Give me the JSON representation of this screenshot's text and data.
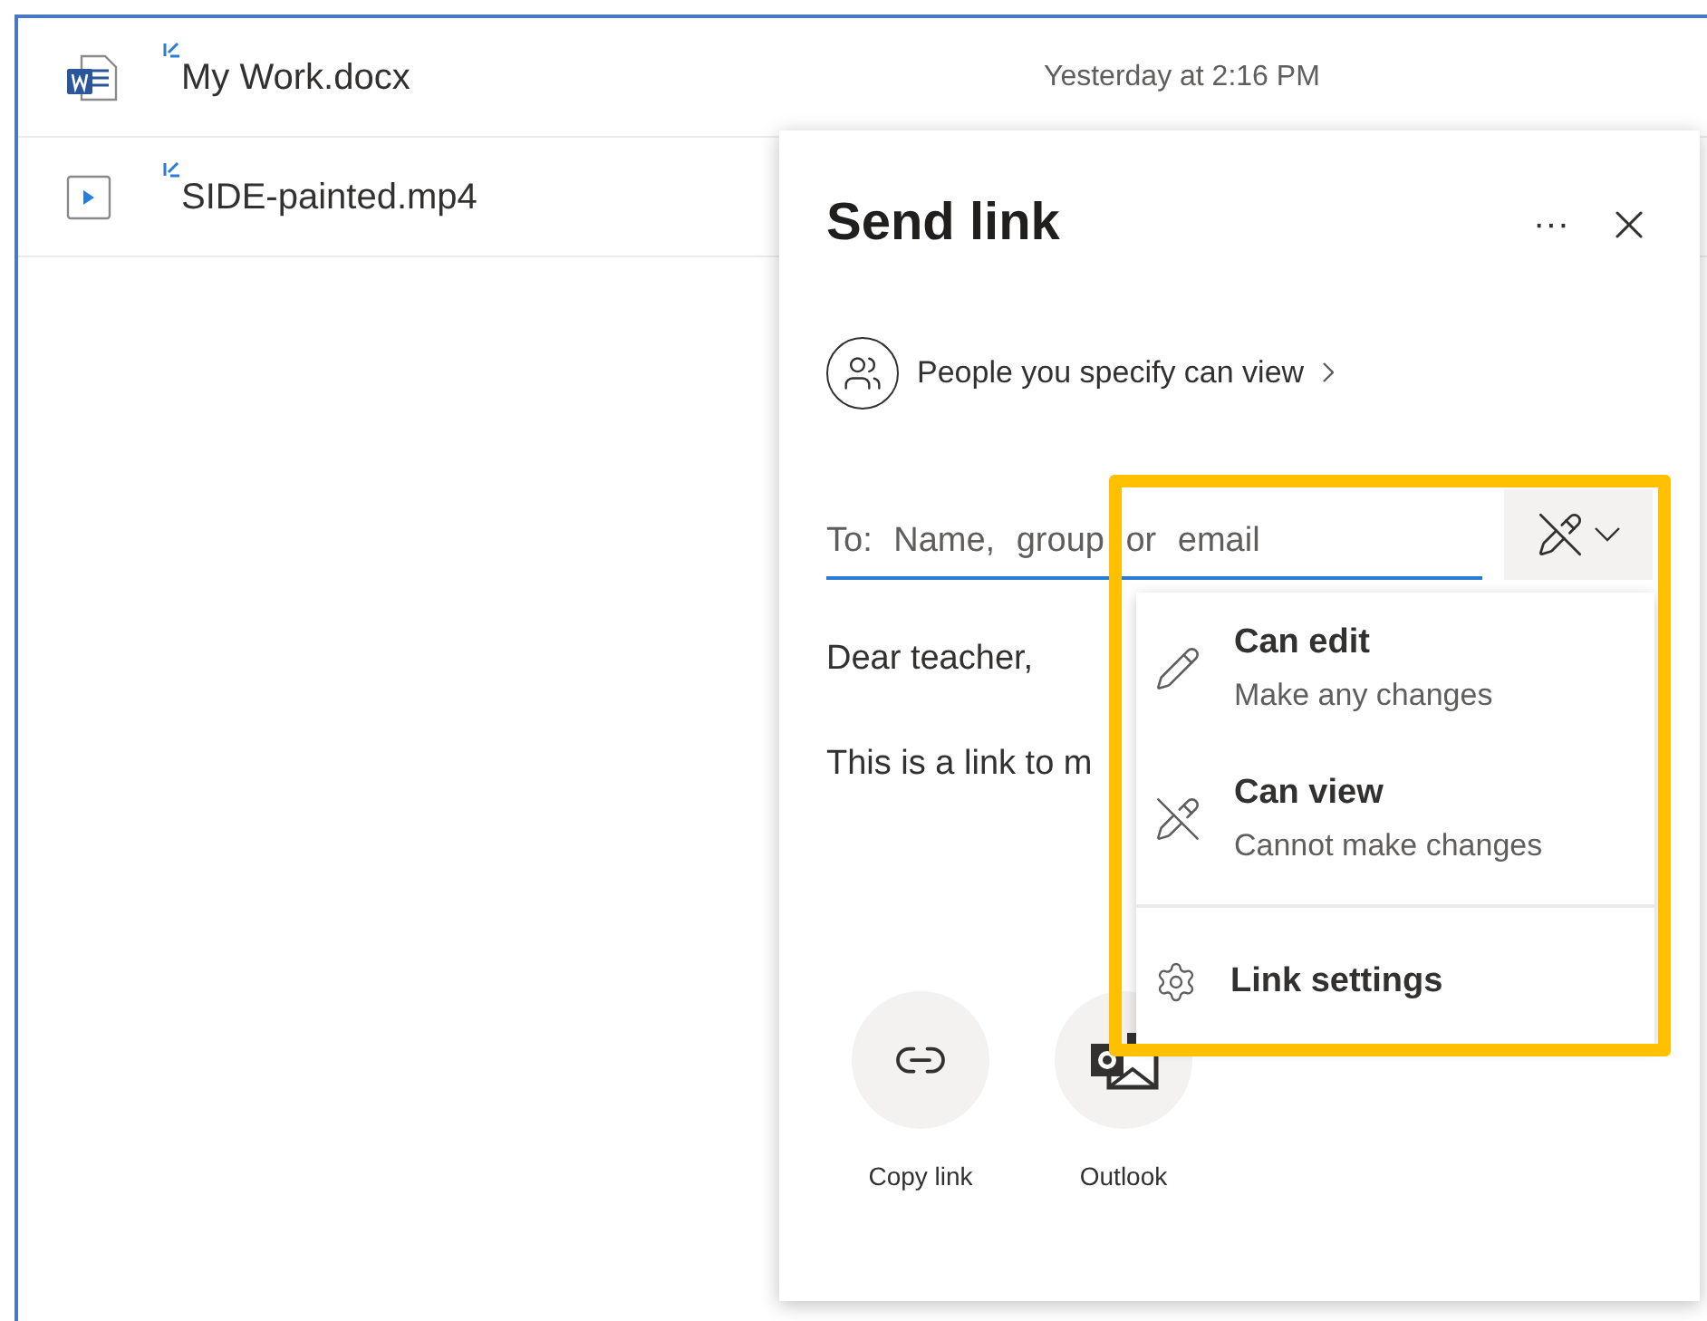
{
  "files": [
    {
      "kind": "word",
      "name": "My Work.docx",
      "new": true,
      "modified": "Yesterday at 2:16 PM"
    },
    {
      "kind": "video",
      "name": "SIDE-painted.mp4",
      "new": true
    }
  ],
  "dialog": {
    "title": "Send link",
    "more": "···",
    "audience": "People you specify can view",
    "recipient": {
      "placeholder": "To: Name, group or email"
    },
    "permission_view_only": true,
    "message": [
      "Dear teacher,",
      "This is a link to m"
    ],
    "share": [
      {
        "kind": "link",
        "label": "Copy link"
      },
      {
        "kind": "outlook",
        "label": "Outlook"
      }
    ]
  },
  "menu": [
    {
      "kind": "edit",
      "title": "Can edit",
      "subtitle": "Make any changes"
    },
    {
      "kind": "view",
      "title": "Can view",
      "subtitle": "Cannot make changes"
    },
    {
      "kind": "settings",
      "title": "Link settings"
    }
  ],
  "highlight": {
    "color": "#ffc000"
  }
}
